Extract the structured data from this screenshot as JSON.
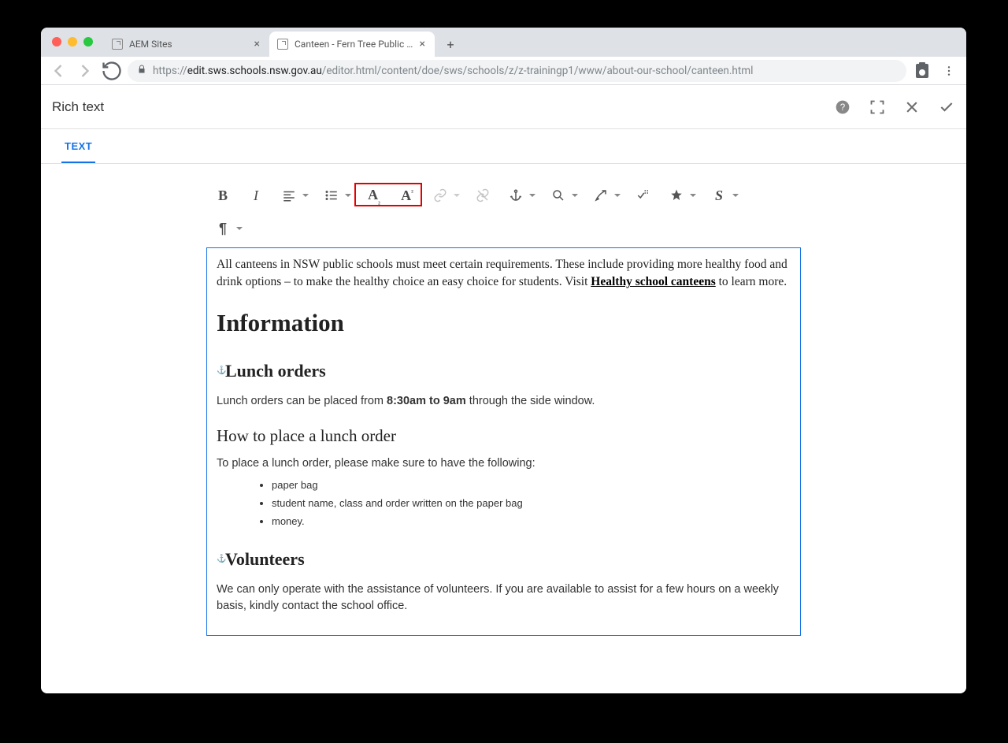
{
  "browser": {
    "tabs": [
      {
        "label": "AEM Sites",
        "active": false
      },
      {
        "label": "Canteen - Fern Tree Public Sch",
        "active": true
      }
    ],
    "url_host": "edit.sws.schools.nsw.gov.au",
    "url_path": "/editor.html/content/doe/sws/schools/z/z-trainingp1/www/about-our-school/canteen.html"
  },
  "header": {
    "title": "Rich text"
  },
  "tab_rail": {
    "active": "TEXT"
  },
  "toolbar": {
    "bold": "B",
    "italic": "I",
    "subscript": "A",
    "subscript_mark": "₂",
    "superscript": "A",
    "superscript_mark": "²",
    "para": "¶",
    "source": "S"
  },
  "content": {
    "intro_a": "All canteens in NSW public schools must meet certain requirements. These include providing more healthy food and drink options – to make the healthy choice an easy choice for students. Visit ",
    "intro_link": "Healthy school canteens",
    "intro_b": " to learn more.",
    "h1": "Information",
    "h2_lunch": "Lunch orders",
    "lunch_p_a": "Lunch orders can be placed from ",
    "lunch_p_bold": "8:30am to 9am",
    "lunch_p_b": " through the side window.",
    "h3_howto": "How to place a lunch order",
    "howto_intro": "To place a lunch order, please make sure to have the following:",
    "howto_items": [
      "paper bag",
      "student name, class and order written on the paper bag",
      "money."
    ],
    "h2_vol": "Volunteers",
    "vol_p": "We can only operate with the assistance of volunteers. If you are available to assist for a few hours on a weekly basis, kindly contact the school office."
  }
}
